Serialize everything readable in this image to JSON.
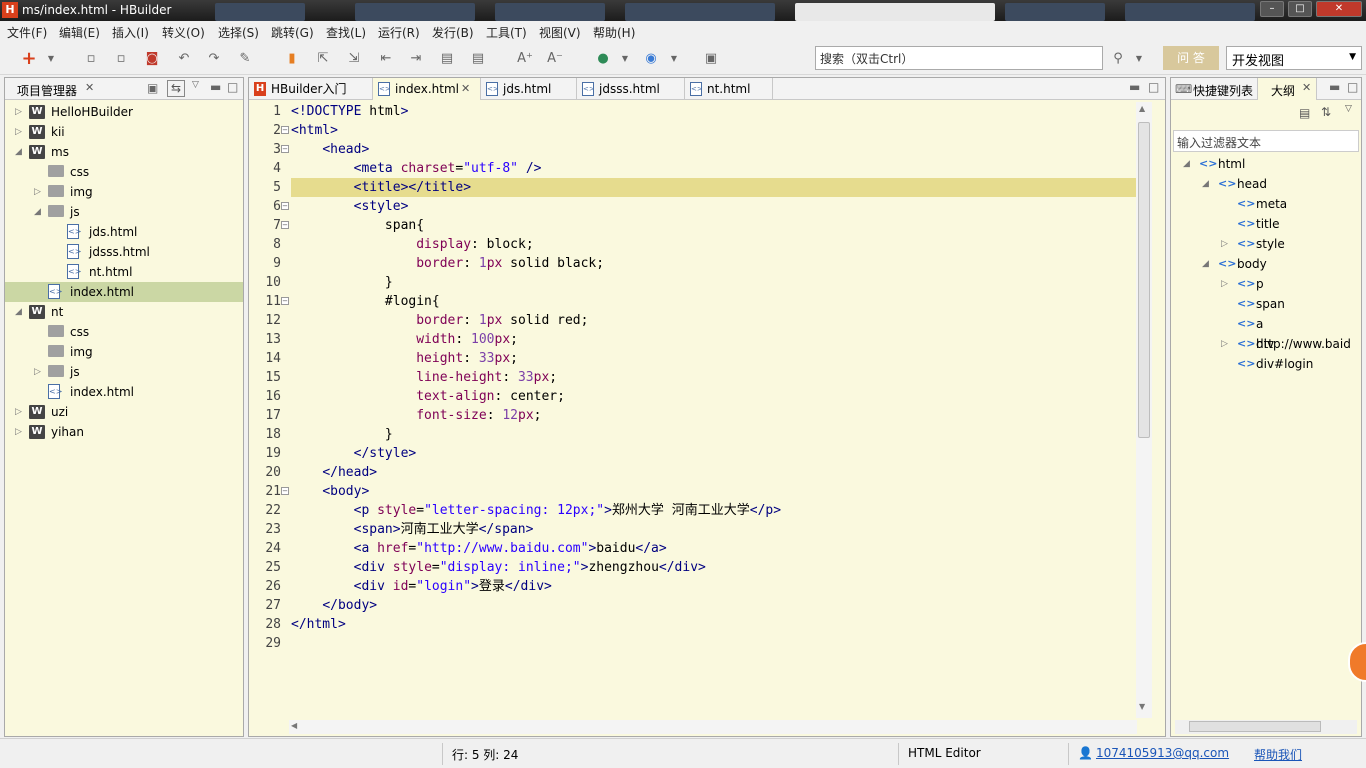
{
  "window": {
    "title": "ms/index.html  -  HBuilder",
    "logo": "H",
    "min": "–",
    "max": "□",
    "close": "✕"
  },
  "menu": [
    "文件(F)",
    "编辑(E)",
    "插入(I)",
    "转义(O)",
    "选择(S)",
    "跳转(G)",
    "查找(L)",
    "运行(R)",
    "发行(B)",
    "工具(T)",
    "视图(V)",
    "帮助(H)"
  ],
  "toolbar": {
    "search_placeholder": "搜索（双击Ctrl）",
    "ask_label": "问 答",
    "view_value": "开发视图"
  },
  "project_panel": {
    "title": "项目管理器",
    "tree": [
      {
        "label": "HelloHBuilder",
        "type": "project",
        "state": "collapsed",
        "level": 0
      },
      {
        "label": "kii",
        "type": "project",
        "state": "collapsed",
        "level": 0
      },
      {
        "label": "ms",
        "type": "project",
        "state": "expanded",
        "level": 0
      },
      {
        "label": "css",
        "type": "folder",
        "state": "none",
        "level": 1
      },
      {
        "label": "img",
        "type": "folder",
        "state": "collapsed",
        "level": 1
      },
      {
        "label": "js",
        "type": "folder",
        "state": "expanded",
        "level": 1
      },
      {
        "label": "jds.html",
        "type": "file",
        "state": "none",
        "level": 2
      },
      {
        "label": "jdsss.html",
        "type": "file",
        "state": "none",
        "level": 2
      },
      {
        "label": "nt.html",
        "type": "file",
        "state": "none",
        "level": 2
      },
      {
        "label": "index.html",
        "type": "file",
        "state": "selected",
        "level": 1
      },
      {
        "label": "nt",
        "type": "project",
        "state": "expanded",
        "level": 0
      },
      {
        "label": "css",
        "type": "folder",
        "state": "none",
        "level": 1
      },
      {
        "label": "img",
        "type": "folder",
        "state": "none",
        "level": 1
      },
      {
        "label": "js",
        "type": "folder",
        "state": "collapsed",
        "level": 1
      },
      {
        "label": "index.html",
        "type": "file",
        "state": "none",
        "level": 1
      },
      {
        "label": "uzi",
        "type": "project",
        "state": "collapsed",
        "level": 0
      },
      {
        "label": "yihan",
        "type": "project",
        "state": "collapsed",
        "level": 0
      }
    ]
  },
  "editor": {
    "tabs": [
      {
        "label": "HBuilder入门",
        "active": false,
        "icon": "H"
      },
      {
        "label": "index.html",
        "active": true,
        "icon": "<>"
      },
      {
        "label": "jds.html",
        "active": false,
        "icon": "<>"
      },
      {
        "label": "jdsss.html",
        "active": false,
        "icon": "<>"
      },
      {
        "label": "nt.html",
        "active": false,
        "icon": "<>"
      }
    ],
    "current_line": 5,
    "lines": [
      "<!DOCTYPE html>",
      "<html>",
      "    <head>",
      "        <meta charset=\"utf-8\" />",
      "        <title></title>",
      "        <style>",
      "            span{",
      "                display: block;",
      "                border: 1px solid black;",
      "            }",
      "            #login{",
      "                border: 1px solid red;",
      "                width: 100px;",
      "                height: 33px;",
      "                line-height: 33px;",
      "                text-align: center;",
      "                font-size: 12px;",
      "            }",
      "        </style>",
      "    </head>",
      "    <body>",
      "        <p style=\"letter-spacing: 12px;\">郑州大学 河南工业大学</p>",
      "        <span>河南工业大学</span>",
      "        <a href=\"http://www.baidu.com\">baidu</a>",
      "        <div style=\"display: inline;\">zhengzhou</div>",
      "        <div id=\"login\">登录</div>",
      "    </body>",
      "</html>",
      ""
    ],
    "folds": [
      2,
      3,
      6,
      7,
      11,
      21
    ]
  },
  "right_panel": {
    "tab_shortcuts": "快捷键列表",
    "tab_outline": "大纲",
    "filter_placeholder": "输入过滤器文本",
    "outline": [
      {
        "label": "html",
        "level": 0,
        "state": "expanded"
      },
      {
        "label": "head",
        "level": 1,
        "state": "expanded"
      },
      {
        "label": "meta",
        "level": 2,
        "state": "none"
      },
      {
        "label": "title",
        "level": 2,
        "state": "none"
      },
      {
        "label": "style",
        "level": 2,
        "state": "collapsed"
      },
      {
        "label": "body",
        "level": 1,
        "state": "expanded"
      },
      {
        "label": "p",
        "level": 2,
        "state": "collapsed"
      },
      {
        "label": "span",
        "level": 2,
        "state": "none"
      },
      {
        "label": "a http://www.baid",
        "level": 2,
        "state": "none"
      },
      {
        "label": "div",
        "level": 2,
        "state": "collapsed"
      },
      {
        "label": "div#login",
        "level": 2,
        "state": "none"
      }
    ]
  },
  "status": {
    "position": "行: 5 列: 24",
    "editor_type": "HTML Editor",
    "user": "1074105913@qq.com",
    "help": "帮助我们"
  },
  "colors": {
    "editor_bg": "#faf9de",
    "current_line": "#e6dc8e",
    "selected_tree": "#cbd7a4",
    "brand": "#d9401c"
  }
}
